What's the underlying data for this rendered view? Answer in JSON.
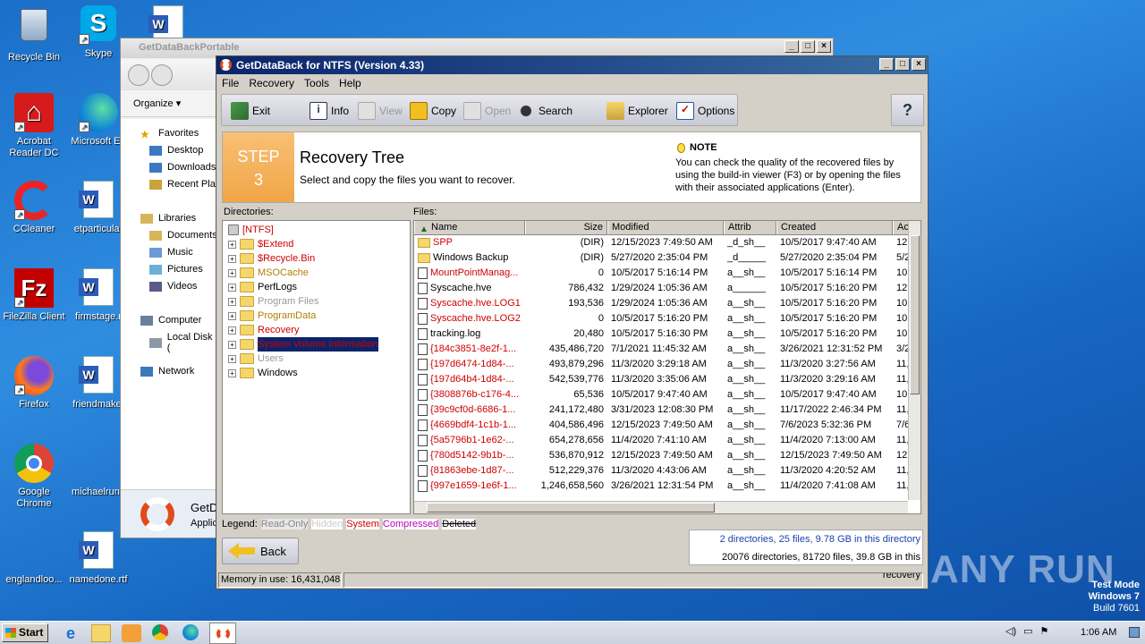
{
  "desktop": {
    "icons": [
      {
        "label": "Recycle Bin",
        "name": "recycle-bin-icon"
      },
      {
        "label": "Skype",
        "name": "skype-icon"
      },
      {
        "label": "Acrobat Reader DC",
        "name": "acrobat-icon"
      },
      {
        "label": "Microsoft Ed",
        "name": "edge-icon"
      },
      {
        "label": "CCleaner",
        "name": "ccleaner-icon"
      },
      {
        "label": "etparticular",
        "name": "word-doc-icon"
      },
      {
        "label": "FileZilla Client",
        "name": "filezilla-icon"
      },
      {
        "label": "firmstage.r",
        "name": "word-doc-icon"
      },
      {
        "label": "Firefox",
        "name": "firefox-icon"
      },
      {
        "label": "friendmake.",
        "name": "word-doc-icon"
      },
      {
        "label": "Google Chrome",
        "name": "chrome-icon"
      },
      {
        "label": "michaelrunn",
        "name": "word-doc-icon"
      },
      {
        "label": "englandloo...",
        "name": "blank-doc-icon"
      },
      {
        "label": "namedone.rtf",
        "name": "word-doc-icon"
      }
    ]
  },
  "explorer": {
    "title": "GetDataBackPortable",
    "organize": "Organize",
    "favorites": "Favorites",
    "nav": [
      "Desktop",
      "Downloads",
      "Recent Pla",
      "Libraries",
      "Documents",
      "Music",
      "Pictures",
      "Videos",
      "Computer",
      "Local Disk (",
      "Network"
    ],
    "status_title": "GetD",
    "status_sub": "Applic"
  },
  "app": {
    "title": "GetDataBack for NTFS (Version 4.33)",
    "menu": [
      "File",
      "Recovery",
      "Tools",
      "Help"
    ],
    "toolbar": {
      "exit": "Exit",
      "info": "Info",
      "view": "View",
      "copy": "Copy",
      "open": "Open",
      "search": "Search",
      "explorer": "Explorer",
      "options": "Options"
    },
    "step": {
      "label": "STEP",
      "num": "3",
      "title": "Recovery Tree",
      "subtitle": "Select and copy the files you want to recover."
    },
    "note": {
      "head": "NOTE",
      "text": "You can check the quality of the recovered files by using the build-in viewer (F3) or by opening the files with their associated applications (Enter)."
    },
    "dirs_label": "Directories:",
    "files_label": "Files:",
    "tree_root": "[NTFS]",
    "tree": [
      {
        "name": "$Extend",
        "cls": "red"
      },
      {
        "name": "$Recycle.Bin",
        "cls": "red"
      },
      {
        "name": "MSOCache",
        "cls": "olive"
      },
      {
        "name": "PerfLogs",
        "cls": ""
      },
      {
        "name": "Program Files",
        "cls": "gray"
      },
      {
        "name": "ProgramData",
        "cls": "olive"
      },
      {
        "name": "Recovery",
        "cls": "red"
      },
      {
        "name": "System Volume Information",
        "cls": "sel"
      },
      {
        "name": "Users",
        "cls": "gray"
      },
      {
        "name": "Windows",
        "cls": ""
      }
    ],
    "columns": [
      "Name",
      "Size",
      "Modified",
      "Attrib",
      "Created",
      "Ac"
    ],
    "files": [
      {
        "name": "SPP",
        "size": "(DIR)",
        "mod": "12/15/2023 7:49:50 AM",
        "attr": "_d_sh__",
        "cre": "10/5/2017 9:47:40 AM",
        "ac": "12,",
        "cls": "red",
        "dir": true
      },
      {
        "name": "Windows Backup",
        "size": "(DIR)",
        "mod": "5/27/2020 2:35:04 PM",
        "attr": "_d_____",
        "cre": "5/27/2020 2:35:04 PM",
        "ac": "5/2",
        "cls": "",
        "dir": true
      },
      {
        "name": "MountPointManag...",
        "size": "0",
        "mod": "10/5/2017 5:16:14 PM",
        "attr": "a__sh__",
        "cre": "10/5/2017 5:16:14 PM",
        "ac": "10,",
        "cls": "red"
      },
      {
        "name": "Syscache.hve",
        "size": "786,432",
        "mod": "1/29/2024 1:05:36 AM",
        "attr": "a______",
        "cre": "10/5/2017 5:16:20 PM",
        "ac": "12,",
        "cls": ""
      },
      {
        "name": "Syscache.hve.LOG1",
        "size": "193,536",
        "mod": "1/29/2024 1:05:36 AM",
        "attr": "a__sh__",
        "cre": "10/5/2017 5:16:20 PM",
        "ac": "10,",
        "cls": "red"
      },
      {
        "name": "Syscache.hve.LOG2",
        "size": "0",
        "mod": "10/5/2017 5:16:20 PM",
        "attr": "a__sh__",
        "cre": "10/5/2017 5:16:20 PM",
        "ac": "10,",
        "cls": "red"
      },
      {
        "name": "tracking.log",
        "size": "20,480",
        "mod": "10/5/2017 5:16:30 PM",
        "attr": "a__sh__",
        "cre": "10/5/2017 5:16:20 PM",
        "ac": "10,",
        "cls": ""
      },
      {
        "name": "{184c3851-8e2f-1...",
        "size": "435,486,720",
        "mod": "7/1/2021 11:45:32 AM",
        "attr": "a__sh__",
        "cre": "3/26/2021 12:31:52 PM",
        "ac": "3/2",
        "cls": "red"
      },
      {
        "name": "{197d6474-1d84-...",
        "size": "493,879,296",
        "mod": "11/3/2020 3:29:18 AM",
        "attr": "a__sh__",
        "cre": "11/3/2020 3:27:56 AM",
        "ac": "11,",
        "cls": "red"
      },
      {
        "name": "{197d64b4-1d84-...",
        "size": "542,539,776",
        "mod": "11/3/2020 3:35:06 AM",
        "attr": "a__sh__",
        "cre": "11/3/2020 3:29:16 AM",
        "ac": "11,",
        "cls": "red"
      },
      {
        "name": "{3808876b-c176-4...",
        "size": "65,536",
        "mod": "10/5/2017 9:47:40 AM",
        "attr": "a__sh__",
        "cre": "10/5/2017 9:47:40 AM",
        "ac": "10,",
        "cls": "red"
      },
      {
        "name": "{39c9cf0d-6686-1...",
        "size": "241,172,480",
        "mod": "3/31/2023 12:08:30 PM",
        "attr": "a__sh__",
        "cre": "11/17/2022 2:46:34 PM",
        "ac": "11,",
        "cls": "red"
      },
      {
        "name": "{4669bdf4-1c1b-1...",
        "size": "404,586,496",
        "mod": "12/15/2023 7:49:50 AM",
        "attr": "a__sh__",
        "cre": "7/6/2023 5:32:36 PM",
        "ac": "7/6",
        "cls": "red"
      },
      {
        "name": "{5a5796b1-1e62-...",
        "size": "654,278,656",
        "mod": "11/4/2020 7:41:10 AM",
        "attr": "a__sh__",
        "cre": "11/4/2020 7:13:00 AM",
        "ac": "11,",
        "cls": "red"
      },
      {
        "name": "{780d5142-9b1b-...",
        "size": "536,870,912",
        "mod": "12/15/2023 7:49:50 AM",
        "attr": "a__sh__",
        "cre": "12/15/2023 7:49:50 AM",
        "ac": "12,",
        "cls": "red"
      },
      {
        "name": "{81863ebe-1d87-...",
        "size": "512,229,376",
        "mod": "11/3/2020 4:43:06 AM",
        "attr": "a__sh__",
        "cre": "11/3/2020 4:20:52 AM",
        "ac": "11,",
        "cls": "red"
      },
      {
        "name": "{997e1659-1e6f-1...",
        "size": "1,246,658,560",
        "mod": "3/26/2021 12:31:54 PM",
        "attr": "a__sh__",
        "cre": "11/4/2020 7:41:08 AM",
        "ac": "11,",
        "cls": "red"
      }
    ],
    "legend": {
      "label": "Legend:",
      "readonly": "Read-Only",
      "hidden": "Hidden",
      "system": "System",
      "compressed": "Compressed",
      "deleted": "Deleted"
    },
    "back": "Back",
    "summary1": "2 directories, 25 files, 9.78 GB in this directory",
    "summary2": "20076 directories, 81720 files, 39.8 GB in this recovery",
    "memory": "Memory in use: 16,431,048"
  },
  "watermark": {
    "text": "ANY RUN",
    "mode": "Test Mode",
    "os": "Windows 7",
    "build": "Build 7601"
  },
  "taskbar": {
    "start": "Start",
    "clock": "1:06 AM"
  }
}
